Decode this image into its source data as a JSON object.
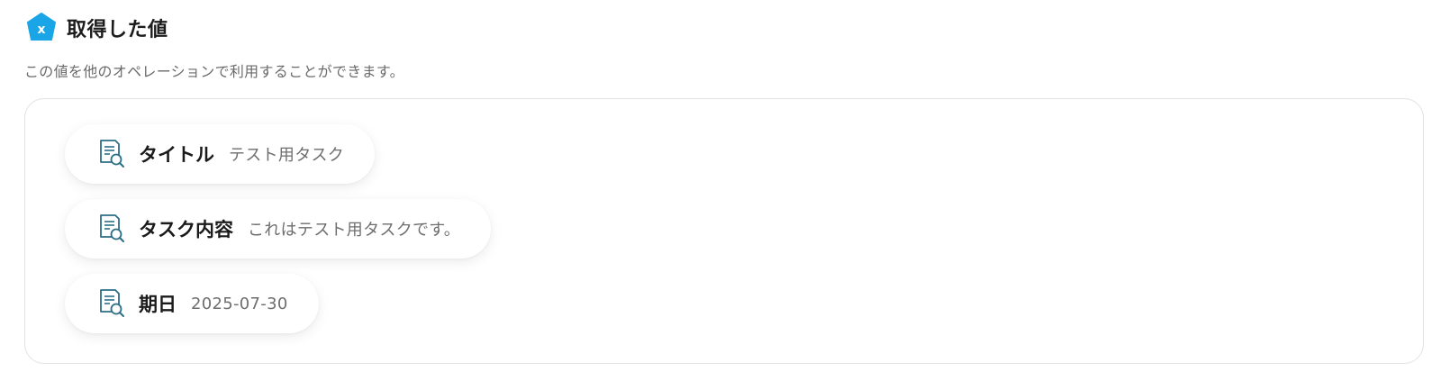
{
  "header": {
    "title": "取得した値",
    "logo_icon": "yoom-pentagon-logo-icon",
    "logo_color": "#1aa6e6"
  },
  "description": "この値を他のオペレーションで利用することができます。",
  "values": [
    {
      "icon": "document-search-icon",
      "label": "タイトル",
      "value": "テスト用タスク"
    },
    {
      "icon": "document-search-icon",
      "label": "タスク内容",
      "value": "これはテスト用タスクです。"
    },
    {
      "icon": "document-search-icon",
      "label": "期日",
      "value": "2025-07-30"
    }
  ],
  "colors": {
    "icon_stroke": "#2b6f86",
    "icon_accent": "#1f8fb0"
  }
}
